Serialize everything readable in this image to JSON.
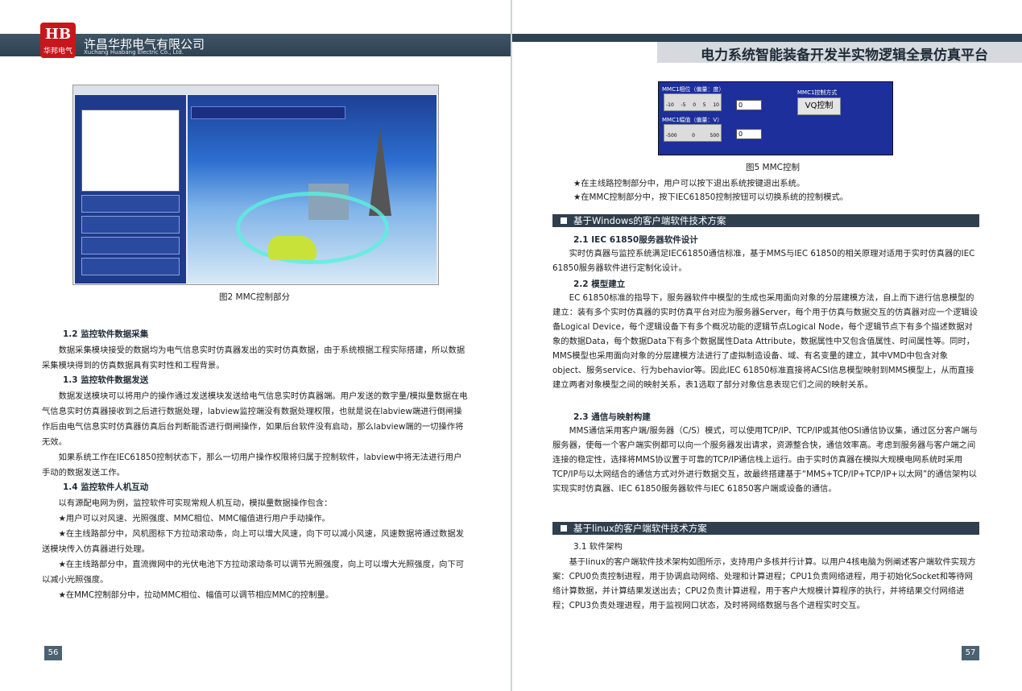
{
  "left_page": {
    "logo_mark": "HB",
    "logo_text": "华邦电气",
    "company_name": "许昌华邦电气有限公司",
    "company_name_en": "Xuchang Huabang Electric Co., Ltd.",
    "figure_caption": "图2 MMC控制部分",
    "sections": [
      {
        "heading": "1.2 监控软件数据采集",
        "paragraphs": [
          "数据采集模块接受的数据均为电气信息实时仿真器发出的实时仿真数据，由于系统根据工程实际搭建，所以数据采集模块得到的仿真数据具有实时性和工程背景。"
        ]
      },
      {
        "heading": "1.3 监控软件数据发送",
        "paragraphs": [
          "数据发送模块可以将用户的操作通过发送模块发送给电气信息实时仿真器端。用户发送的数字量/模拟量数据在电气信息实时仿真器接收到之后进行数据处理，labview监控端没有数据处理权限，也就是说在labview端进行倒闸操作后由电气信息实时仿真器仿真后台判断能否进行倒闸操作，如果后台软件没有启动，那么labview端的一切操作将无效。",
          "如果系统工作在IEC61850控制状态下，那么一切用户操作权限将归属于控制软件，labview中将无法进行用户手动的数据发送工作。"
        ]
      },
      {
        "heading": "1.4 监控软件人机互动",
        "paragraphs": [
          "以有源配电网为例，监控软件可实现常规人机互动，模拟量数据操作包含：",
          "★用户可以对风速、光照强度、MMC相位、MMC幅值进行用户手动操作。",
          "★在主线路部分中，风机图标下方拉动滚动条，向上可以增大风速，向下可以减小风速，风速数据将通过数据发送模块传入仿真器进行处理。",
          "★在主线路部分中，直流微网中的光伏电池下方拉动滚动条可以调节光照强度，向上可以增大光照强度，向下可以减小光照强度。",
          "★在MMC控制部分中，拉动MMC相位、幅值可以调节相应MMC的控制量。"
        ]
      }
    ],
    "page_number": "56"
  },
  "right_page": {
    "header_title": "电力系统智能装备开发半实物逻辑全景仿真平台",
    "fig5": {
      "phase_label": "MMC1相位（偏量：度）",
      "phase_ticks": [
        "-10",
        "-5",
        "0",
        "5",
        "10"
      ],
      "phase_value": "0",
      "amp_label": "MMC1幅值（偏量：V）",
      "amp_ticks": [
        "-500",
        "0",
        "500"
      ],
      "amp_value": "0",
      "mode_label": "MMC1控制方式",
      "mode_button": "VQ控制"
    },
    "figure_caption": "图5 MMC控制",
    "bullets": [
      "★在主线路控制部分中，用户可以按下退出系统按键退出系统。",
      "★在MMC控制部分中，按下IEC61850控制按钮可以切换系统的控制模式。"
    ],
    "section_bar_1": "基于Windows的客户端软件技术方案",
    "sections": [
      {
        "heading": "2.1 IEC 61850服务器软件设计",
        "paragraphs": [
          "实时仿真器与监控系统满足IEC61850通信标准，基于MMS与IEC 61850的相关原理对适用于实时仿真器的IEC 61850服务器软件进行定制化设计。"
        ]
      },
      {
        "heading": "2.2 模型建立",
        "paragraphs": [
          "EC 61850标准的指导下，服务器软件中模型的生成也采用面向对象的分层建模方法，自上而下进行信息模型的建立：装有多个实时仿真器的实时仿真平台对应为服务器Server，每个用于仿真与数据交互的仿真器对应一个逻辑设备Logical Device，每个逻辑设备下有多个概况功能的逻辑节点Logical Node，每个逻辑节点下有多个描述数据对象的数据Data，每个数据Data下有多个数据属性Data Attribute，数据属性中又包含值属性、时间属性等。同时，MMS模型也采用面向对象的分层建模方法进行了虚拟制造设备、域、有名变量的建立，其中VMD中包含对象object、服务service、行为behavior等。因此IEC 61850标准直接将ACSI信息模型映射到MMS模型上，从而直接建立两者对象模型之间的映射关系，表1选取了部分对象信息表现它们之间的映射关系。"
        ]
      },
      {
        "heading": "2.3 通信与映射构建",
        "paragraphs": [
          "MMS通信采用客户端/服务器（C/S）模式，可以使用TCP/IP、TCP/IP或其他OSI通信协议集，通过区分客户端与服务器，使每一个客户端实例都可以向一个服务器发出请求，资源整合快，通信效率高。考虑到服务器与客户端之间连接的稳定性，选择将MMS协议置于可靠的TCP/IP通信栈上运行。由于实时仿真器在模拟大规模电网系统时采用TCP/IP与以太网结合的通信方式对外进行数据交互，故最终搭建基于“MMS+TCP/IP+TCP/IP+以太网”的通信架构以实现实时仿真器、IEC 61850服务器软件与IEC 61850客户端或设备的通信。"
        ]
      }
    ],
    "section_bar_2": "基于linux的客户端软件技术方案",
    "section_31": {
      "heading": "3.1 软件架构",
      "paragraph": "基于linux的客户端软件技术架构如图所示，支持用户多核并行计算。以用户4核电脑为例阐述客户端软件实现方案：CPU0负责控制进程，用于协调启动网络、处理和计算进程；CPU1负责网络进程，用于初始化Socket和等待网络计算数据，并计算结果发送出去；CPU2负责计算进程，用于客户大规模计算程序的执行，并将结果交付网络进程；CPU3负责处理进程，用于监视网口状态，及时将网络数据与各个进程实时交互。"
    },
    "page_number": "57"
  }
}
